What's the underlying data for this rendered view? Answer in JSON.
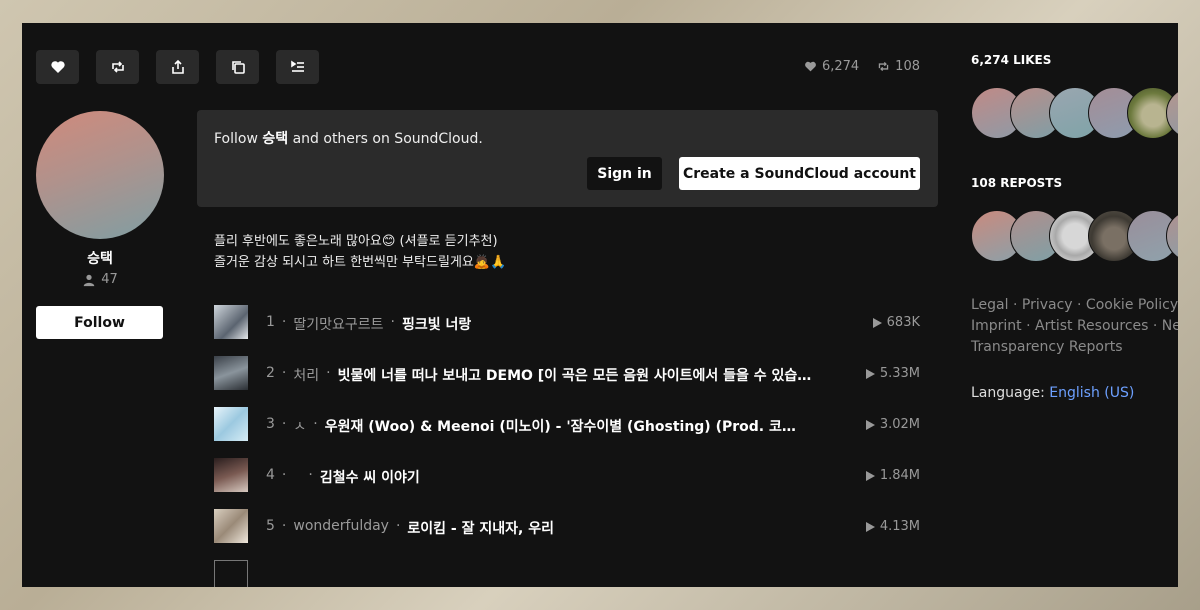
{
  "toolbar": {
    "buttons": [
      {
        "name": "like-button",
        "icon": "heart-icon"
      },
      {
        "name": "repost-button",
        "icon": "repost-icon"
      },
      {
        "name": "share-button",
        "icon": "share-icon"
      },
      {
        "name": "copy-link-button",
        "icon": "copy-icon"
      },
      {
        "name": "add-to-queue-button",
        "icon": "queue-icon"
      }
    ],
    "likes_count": "6,274",
    "reposts_count": "108"
  },
  "user": {
    "name": "승택",
    "followers": "47",
    "follow_label": "Follow"
  },
  "promo": {
    "prefix": "Follow ",
    "user": "승택",
    "suffix": " and others on SoundCloud.",
    "signin_label": "Sign in",
    "create_label": "Create a SoundCloud account"
  },
  "description": {
    "line1": "플리 후반에도 좋은노래 많아요😊 (셔플로 듣기추천)",
    "line2": "즐거운 감상 되시고 하트 한번씩만 부탁드릴게요🙇🙏"
  },
  "tracks": [
    {
      "num": "1",
      "artist": "딸기맛요구르트",
      "title": "핑크빛 너랑",
      "plays": "683K"
    },
    {
      "num": "2",
      "artist": "처리",
      "title": "빗물에 너를 떠나 보내고 DEMO [이 곡은 모든 음원 사이트에서 들을 수 있습니다]",
      "plays": "5.33M"
    },
    {
      "num": "3",
      "artist": "ㅅ",
      "title": "우원재 (Woo) & Meenoi (미노이) - '잠수이별 (Ghosting) (Prod. 코드 쿤스트)'",
      "plays": "3.02M"
    },
    {
      "num": "4",
      "artist": "",
      "title": "김철수 씨 이야기",
      "plays": "1.84M"
    },
    {
      "num": "5",
      "artist": "wonderfulday",
      "title": "로이킴 - 잘 지내자, 우리",
      "plays": "4.13M"
    }
  ],
  "sidebar": {
    "likes_heading": "6,274 LIKES",
    "reposts_heading": "108 REPOSTS",
    "footer_line1": "Legal · Privacy · Cookie Policy",
    "footer_line2": "Imprint · Artist Resources · Ne",
    "footer_line3": "Transparency Reports",
    "language_label": "Language: ",
    "language_value": "English (US)"
  },
  "colors": {
    "background": "#121212",
    "panel": "#2b2b2b",
    "link": "#6da0ff"
  }
}
